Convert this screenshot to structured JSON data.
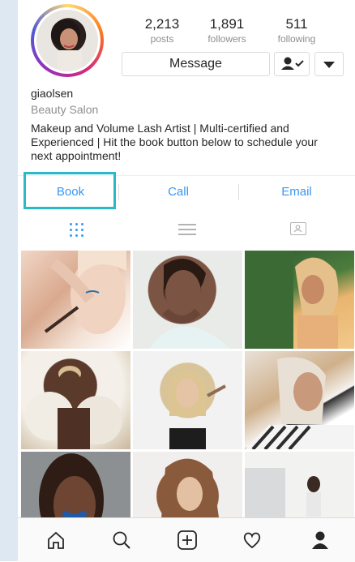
{
  "profile": {
    "posts_count": "2,213",
    "posts_label": "posts",
    "followers_count": "1,891",
    "followers_label": "followers",
    "following_count": "511",
    "following_label": "following",
    "message_label": "Message",
    "username": "giaolsen",
    "category": "Beauty Salon",
    "bio": "Makeup and Volume Lash Artist | Multi-certified and Experienced | Hit the book button below to schedule your next appointment!"
  },
  "contact": {
    "book_label": "Book",
    "call_label": "Call",
    "email_label": "Email"
  },
  "tabs": [
    "grid-icon",
    "list-icon",
    "tagged-icon"
  ],
  "grid": {
    "tiles": 9
  },
  "nav": [
    "home-icon",
    "search-icon",
    "add-icon",
    "heart-icon",
    "profile-icon"
  ],
  "colors": {
    "link": "#3897f0",
    "highlight": "#29b9c8",
    "text": "#262626",
    "muted": "#8e8e8e"
  }
}
